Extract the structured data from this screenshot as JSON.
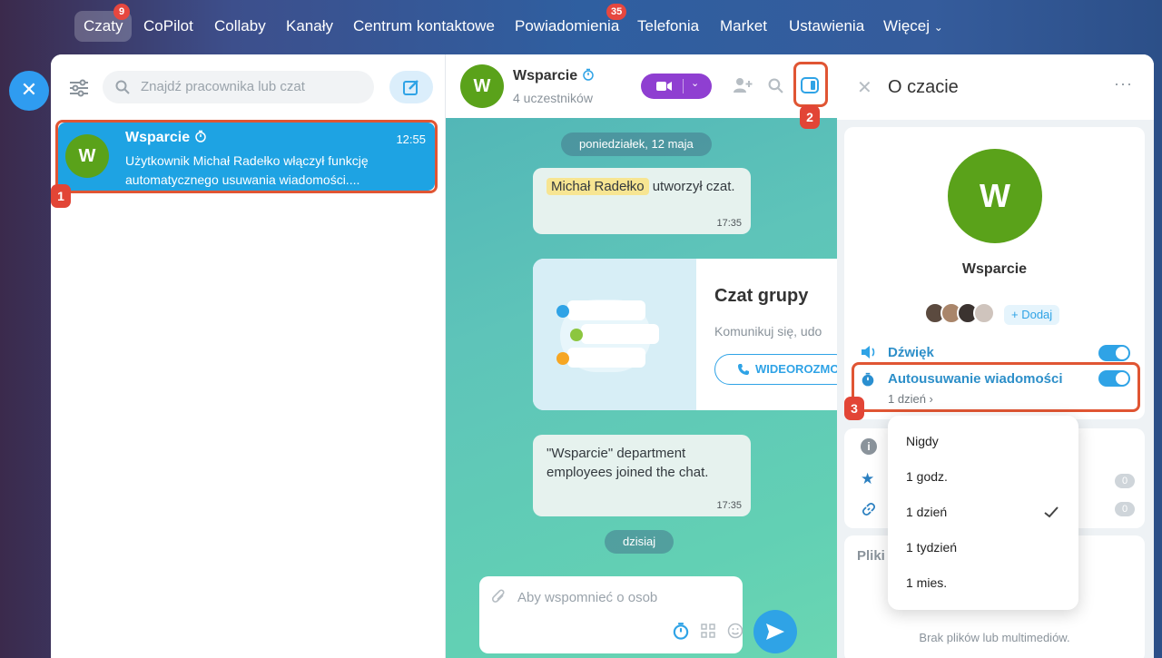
{
  "nav": {
    "items": [
      {
        "label": "Czaty",
        "badge": "9"
      },
      {
        "label": "CoPilot"
      },
      {
        "label": "Collaby"
      },
      {
        "label": "Kanały"
      },
      {
        "label": "Centrum kontaktowe"
      },
      {
        "label": "Powiadomienia",
        "badge": "35"
      },
      {
        "label": "Telefonia"
      },
      {
        "label": "Market"
      },
      {
        "label": "Ustawienia"
      },
      {
        "label": "Więcej"
      }
    ]
  },
  "left": {
    "search_placeholder": "Znajdź pracownika lub czat",
    "chat": {
      "avatar": "W",
      "name": "Wsparcie",
      "time": "12:55",
      "preview": "Użytkownik Michał Radełko włączył funkcję automatycznego usuwania wiadomości...."
    }
  },
  "chat": {
    "avatar": "W",
    "title": "Wsparcie",
    "subtitle": "4 uczestników",
    "date1": "poniedziałek, 12 maja",
    "msg1_name": "Michał Radełko",
    "msg1_text": " utworzył czat.",
    "msg1_time": "17:35",
    "card_title": "Czat grupy",
    "card_text": "Komunikuj się, udo",
    "card_button": "WIDEOROZMO",
    "msg2_text": "\"Wsparcie\" department employees joined the chat.",
    "msg2_time": "17:35",
    "date2": "dzisiaj",
    "input_placeholder": "Aby wspomnieć o osob"
  },
  "panel": {
    "title": "O czacie",
    "avatar": "W",
    "name": "Wsparcie",
    "add_label": "+ Dodaj",
    "sound_label": "Dźwięk",
    "autodelete_label": "Autousuwanie wiadomości",
    "autodelete_value": "1 dzień",
    "files_label": "Pliki",
    "no_files": "Brak plików lub multimediów.",
    "count_fav": "0",
    "count_links": "0"
  },
  "dropdown": {
    "options": [
      "Nigdy",
      "1 godz.",
      "1 dzień",
      "1 tydzień",
      "1 mies."
    ],
    "selected": "1 dzień"
  },
  "steps": [
    "1",
    "2",
    "3"
  ],
  "colors": {
    "accent": "#1ea3e3",
    "avatar": "#5aa21a",
    "callout": "#e05533",
    "video": "#8f3fd1"
  }
}
